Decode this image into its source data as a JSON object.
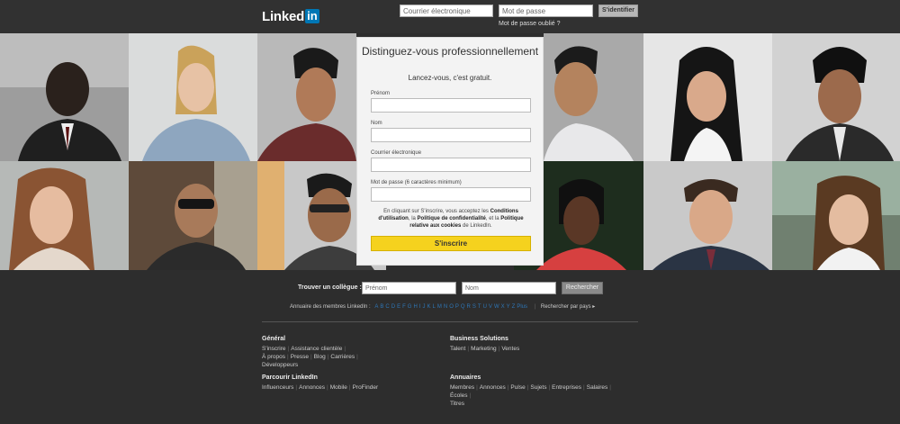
{
  "header": {
    "logo_text": "Linked",
    "logo_box": "in",
    "email_placeholder": "Courrier électronique",
    "password_placeholder": "Mot de passe",
    "signin_label": "S'identifier",
    "forgot_link": "Mot de passe oublié ?"
  },
  "signup": {
    "title": "Distinguez-vous professionnellement",
    "subtitle": "Lancez-vous, c'est gratuit.",
    "fields": [
      {
        "label": "Prénom"
      },
      {
        "label": "Nom"
      },
      {
        "label": "Courrier électronique"
      },
      {
        "label": "Mot de passe (6 caractères minimum)"
      }
    ],
    "terms": {
      "prefix": "En cliquant sur S'inscrire, vous acceptez les ",
      "conditions": "Conditions d'utilisation",
      "mid1": ", la ",
      "privacy": "Politique de confidentialité",
      "mid2": ", et la ",
      "cookies": "Politique relative aux cookies",
      "suffix": " de LinkedIn."
    },
    "submit_label": "S'inscrire"
  },
  "find": {
    "label": "Trouver un collègue :",
    "first_placeholder": "Prénom",
    "last_placeholder": "Nom",
    "search_label": "Rechercher"
  },
  "directory": {
    "label": "Annuaire des membres LinkedIn :",
    "letters": [
      "A",
      "B",
      "C",
      "D",
      "E",
      "F",
      "G",
      "H",
      "I",
      "J",
      "K",
      "L",
      "M",
      "N",
      "O",
      "P",
      "Q",
      "R",
      "S",
      "T",
      "U",
      "V",
      "W",
      "X",
      "Y",
      "Z",
      "Plus"
    ],
    "country_link": "Rechercher par pays ▸"
  },
  "footer": {
    "general": {
      "title": "Général",
      "links": [
        "S'inscrire",
        "Assistance clientèle",
        "À propos",
        "Presse",
        "Blog",
        "Carrières",
        "Développeurs"
      ]
    },
    "business": {
      "title": "Business Solutions",
      "links": [
        "Talent",
        "Marketing",
        "Ventes"
      ]
    },
    "browse": {
      "title": "Parcourir LinkedIn",
      "links": [
        "Influenceurs",
        "Annonces",
        "Mobile",
        "ProFinder"
      ]
    },
    "directories": {
      "title": "Annuaires",
      "links": [
        "Membres",
        "Annonces",
        "Pulse",
        "Sujets",
        "Entreprises",
        "Salaires",
        "Écoles",
        "Titres"
      ]
    }
  },
  "colors": {
    "topbar": "#313131",
    "background": "#2d2d2d",
    "brand_blue": "#0077b5",
    "signup_button": "#f5d21e",
    "link_blue": "#2e76b6"
  }
}
